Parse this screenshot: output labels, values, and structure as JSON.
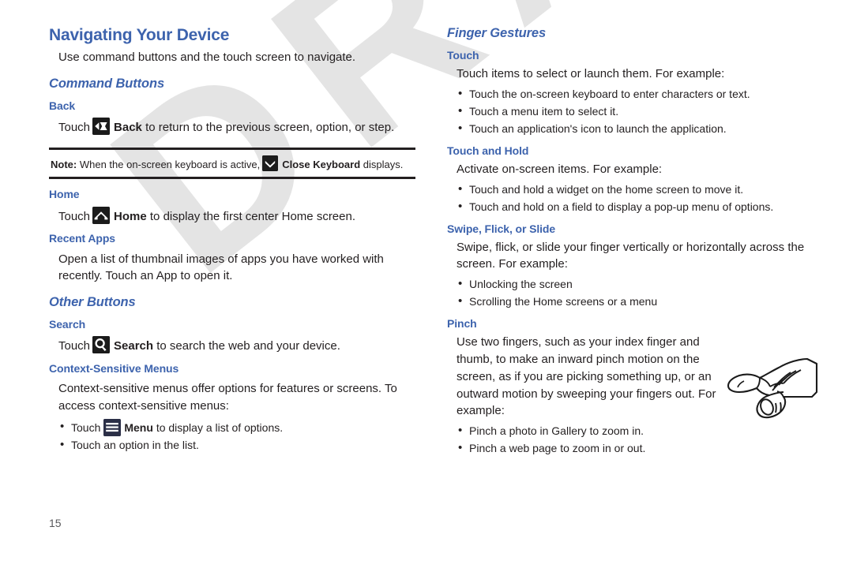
{
  "page": {
    "number": "15",
    "watermark": "DRAFT",
    "heading_color": "#3d63ad",
    "text_color": "#231f20",
    "watermark_color": "#e4e4e4"
  },
  "left_column": {
    "title": "Navigating Your Device",
    "intro": "Use command buttons and the touch screen to navigate.",
    "command_buttons": {
      "heading": "Command Buttons",
      "back": {
        "heading": "Back",
        "line_prefix": "Touch",
        "icon": "back-arrow-icon",
        "label": "Back",
        "line_suffix": "to return to the previous screen, option, or step."
      },
      "note": {
        "label": "Note:",
        "text_before": "When the on-screen keyboard is active,",
        "icon": "close-keyboard-chevron-icon",
        "label_bold": "Close Keyboard",
        "text_after": "displays."
      },
      "home": {
        "heading": "Home",
        "line_prefix": "Touch",
        "icon": "home-house-icon",
        "label": "Home",
        "line_suffix": "to display the first center Home screen."
      },
      "recent_apps": {
        "heading": "Recent Apps",
        "body": "Open a list of thumbnail images of apps you have worked with recently. Touch an App to open it."
      }
    },
    "other_buttons": {
      "heading": "Other Buttons",
      "search": {
        "heading": "Search",
        "line_prefix": "Touch",
        "icon": "search-magnifier-icon",
        "label": "Search",
        "line_suffix": "to search the web and your device."
      },
      "context_menus": {
        "heading": "Context-Sensitive Menus",
        "body": "Context-sensitive menus offer options for features or screens. To access context-sensitive menus:",
        "bullet_menu": {
          "prefix": "Touch",
          "icon": "menu-hamburger-icon",
          "label": "Menu",
          "suffix": "to display a list of options."
        },
        "bullet_option": "Touch an option in the list."
      }
    }
  },
  "right_column": {
    "title": "Finger Gestures",
    "touch": {
      "heading": "Touch",
      "body": "Touch items to select or launch them. For example:",
      "bullets": [
        "Touch the on-screen keyboard to enter characters or text.",
        "Touch a menu item to select it.",
        "Touch an application's icon to launch the application."
      ]
    },
    "touch_and_hold": {
      "heading": "Touch and Hold",
      "body": "Activate on-screen items. For example:",
      "bullets": [
        "Touch and hold a widget on the home screen to move it.",
        "Touch and hold on a field to display a pop-up menu of options."
      ]
    },
    "swipe": {
      "heading": "Swipe, Flick, or Slide",
      "body": "Swipe, flick, or slide your finger vertically or horizontally across the screen. For example:",
      "bullets": [
        "Unlocking the screen",
        "Scrolling the Home screens or a menu"
      ]
    },
    "pinch": {
      "heading": "Pinch",
      "body": "Use two fingers, such as your index finger and thumb, to make an inward pinch motion on the screen, as if you are picking something up, or an outward motion by sweeping your fingers out. For example:",
      "figure": "pinching-hand-illustration",
      "bullets": [
        "Pinch a photo in Gallery to zoom in.",
        "Pinch a web page to zoom in or out."
      ]
    }
  }
}
